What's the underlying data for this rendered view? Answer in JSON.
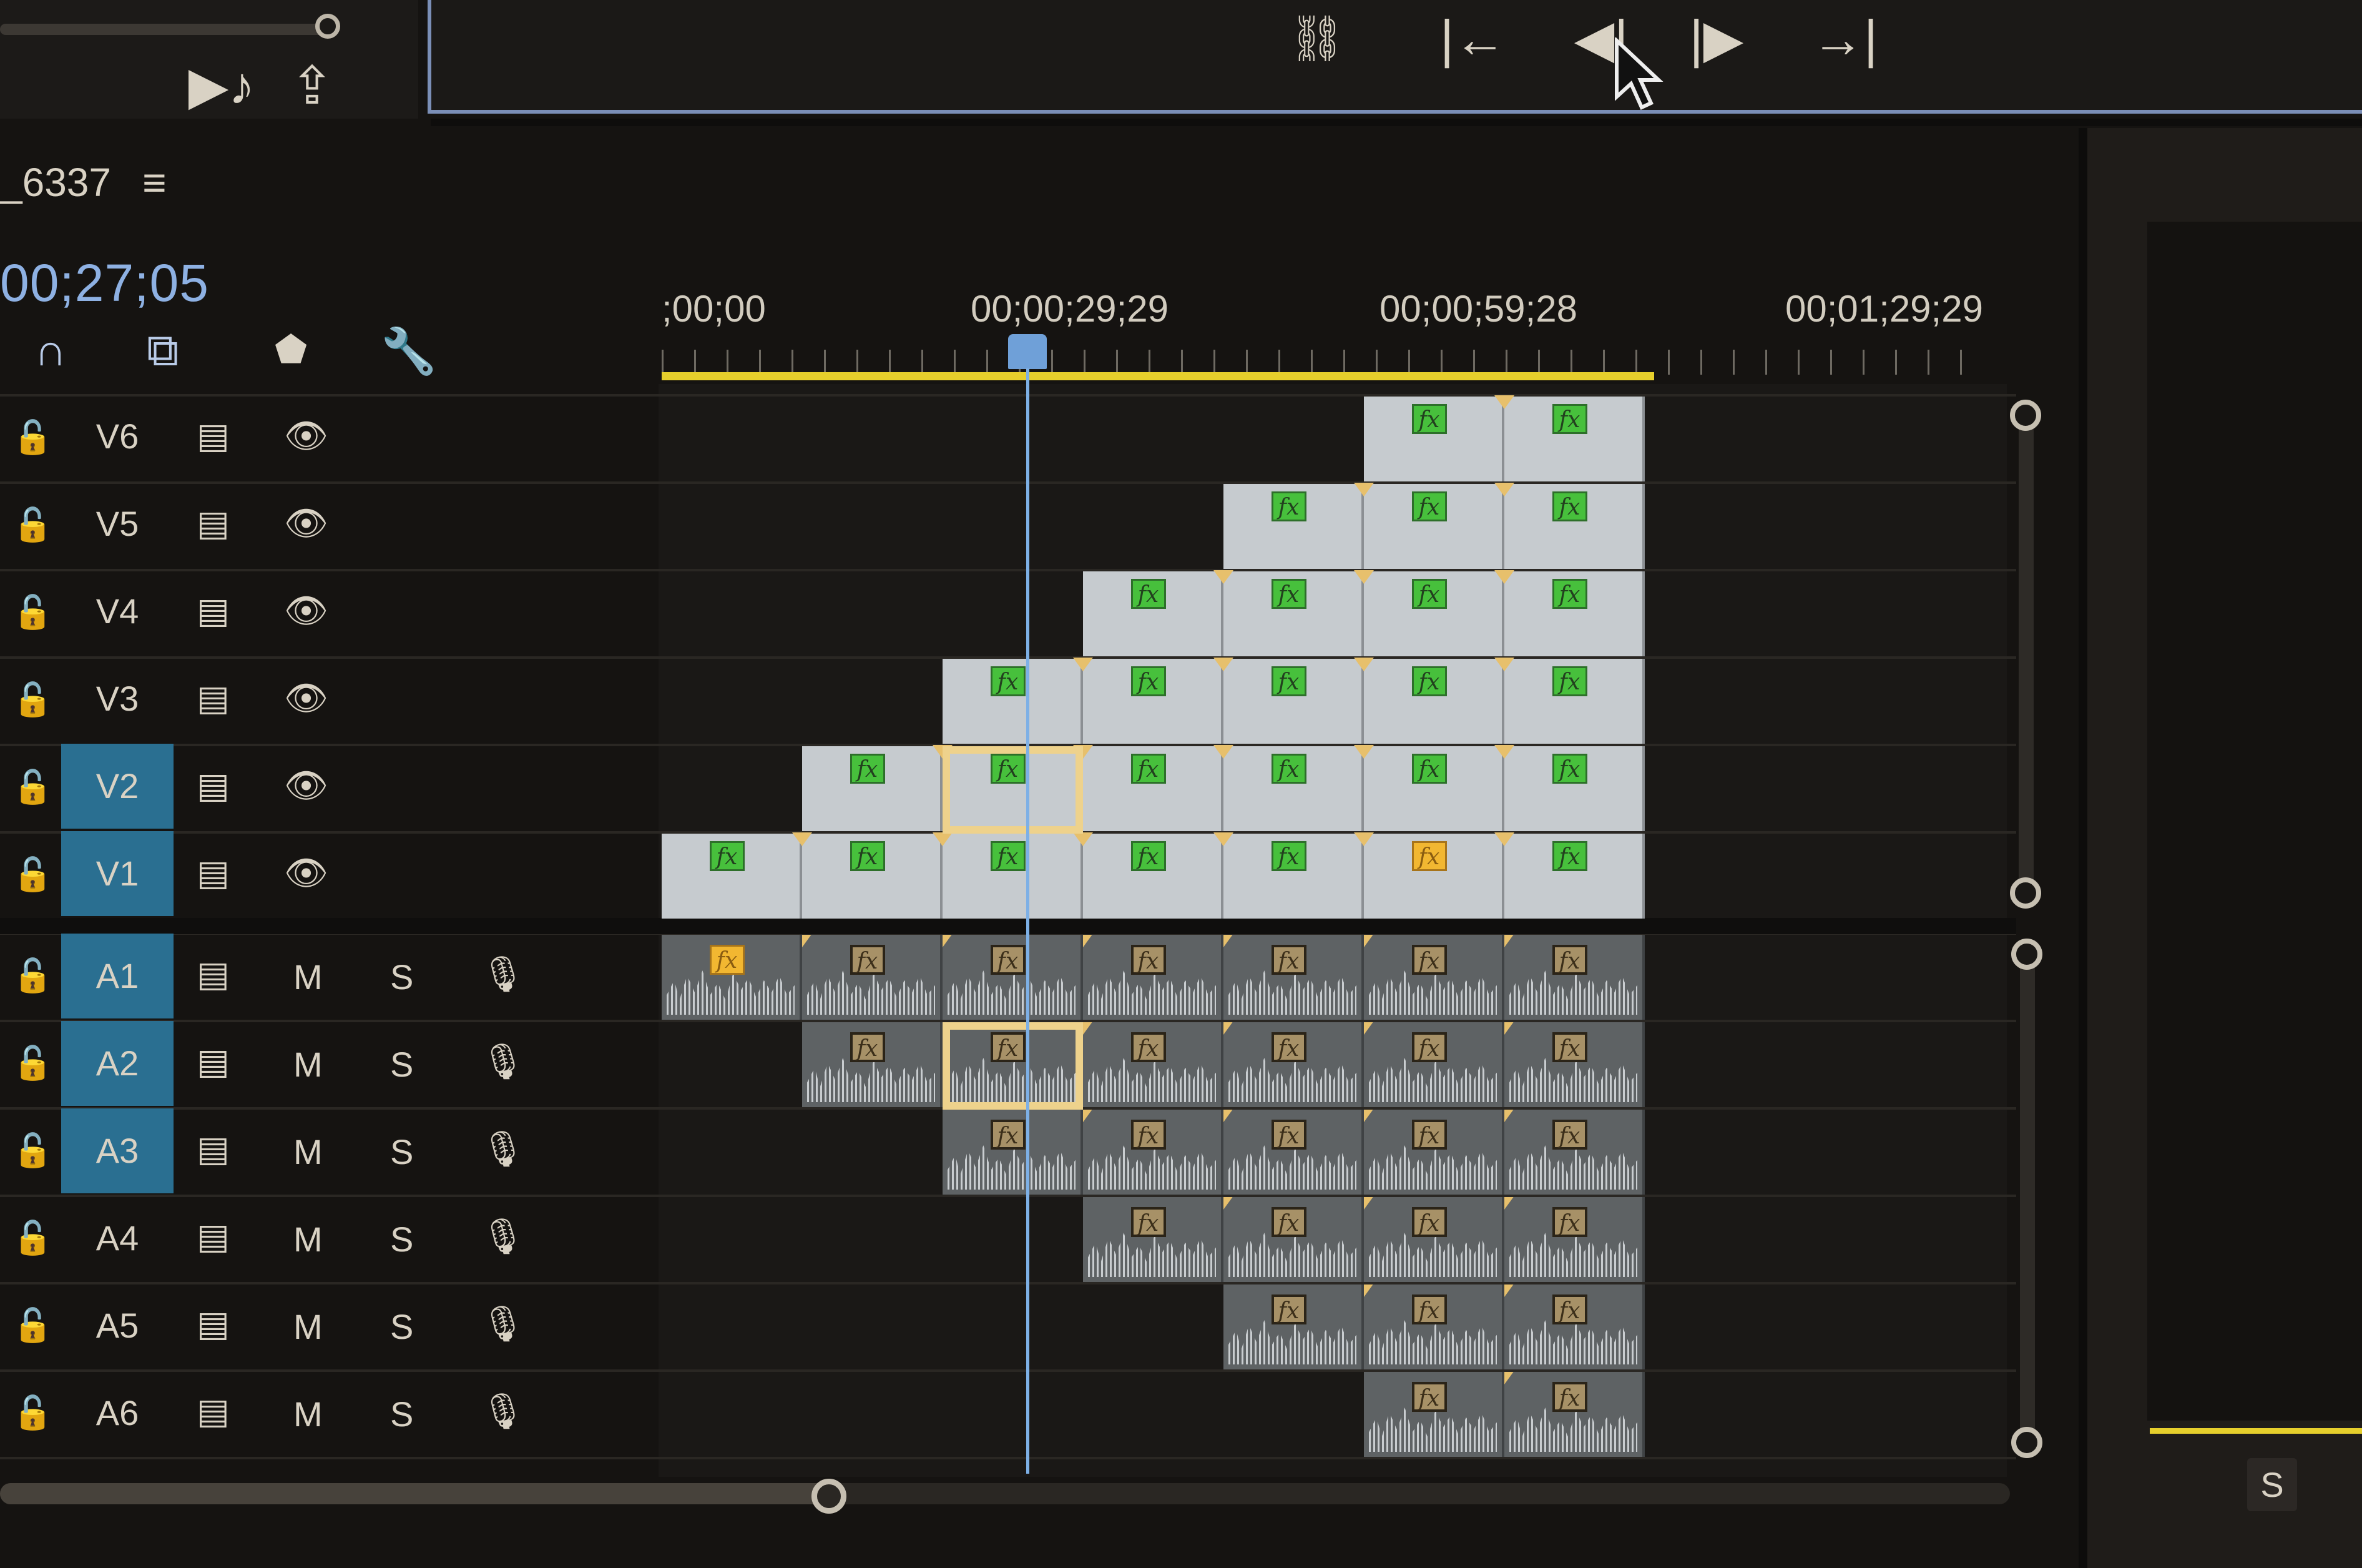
{
  "program_monitor": {
    "transport": [
      {
        "name": "add-marker-link-button",
        "glyph": "⛓"
      },
      {
        "name": "go-to-in-button",
        "glyph": "|←"
      },
      {
        "name": "step-back-button",
        "glyph": "◀|"
      },
      {
        "name": "step-forward-button",
        "glyph": "|▶"
      },
      {
        "name": "go-to-out-button",
        "glyph": "→|"
      }
    ]
  },
  "source_panel": {
    "insert_glyph": "▶♪",
    "export_glyph": "⇪"
  },
  "sequence": {
    "name": "_6337",
    "menu_glyph": "≡",
    "timecode": "00;27;05",
    "tools": {
      "snap": "∩",
      "linked": "⧉",
      "marker": "⬟",
      "wrench": "🔧"
    }
  },
  "ruler": {
    "labels": [
      ";00;00",
      "00;00;29;29",
      "00;00;59;28",
      "00;01;29;29"
    ]
  },
  "video_tracks": [
    {
      "label": "V6",
      "selected": false
    },
    {
      "label": "V5",
      "selected": false
    },
    {
      "label": "V4",
      "selected": false
    },
    {
      "label": "V3",
      "selected": false
    },
    {
      "label": "V2",
      "selected": true
    },
    {
      "label": "V1",
      "selected": true
    }
  ],
  "audio_tracks": [
    {
      "label": "A1",
      "selected": true,
      "mute": "M",
      "solo": "S"
    },
    {
      "label": "A2",
      "selected": true,
      "mute": "M",
      "solo": "S"
    },
    {
      "label": "A3",
      "selected": true,
      "mute": "M",
      "solo": "S"
    },
    {
      "label": "A4",
      "selected": false,
      "mute": "M",
      "solo": "S"
    },
    {
      "label": "A5",
      "selected": false,
      "mute": "M",
      "solo": "S"
    },
    {
      "label": "A6",
      "selected": false,
      "mute": "M",
      "solo": "S"
    }
  ],
  "icons": {
    "lock": "🔓",
    "sync": "▤",
    "eye": "👁",
    "mic": "🎙"
  },
  "fx_label": "fx",
  "right_panel": {
    "button_label": "S"
  },
  "colors": {
    "accent": "#2a6f91",
    "timecode": "#8eb1e3",
    "work_area": "#e6cf2c",
    "fx_green": "#47c03c",
    "fx_yellow": "#f2b731",
    "playhead": "#7db0e6"
  }
}
